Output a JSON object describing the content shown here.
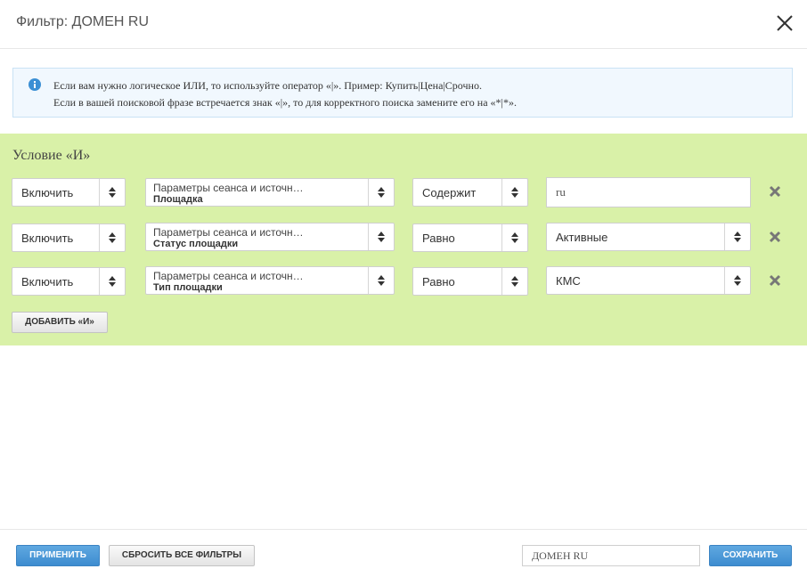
{
  "header": {
    "title": "Фильтр: ДОМЕН RU",
    "close_icon": "close-icon"
  },
  "info": {
    "icon": "info-icon",
    "accent": "#3b8fd4",
    "line1": "Если вам нужно логическое ИЛИ, то используйте оператор «|». Пример: Купить|Цена|Срочно.",
    "line2": "Если в вашей поисковой фразе встречается знак «|», то для корректного поиска замените его на «*|*»."
  },
  "group": {
    "title": "Условие «И»",
    "background": "#d9f1a8",
    "rows": [
      {
        "mode": "Включить",
        "param_line1": "Параметры сеанса и источн…",
        "param_line2": "Площадка",
        "operator": "Содержит",
        "value": "ru"
      },
      {
        "mode": "Включить",
        "param_line1": "Параметры сеанса и источн…",
        "param_line2": "Статус площадки",
        "operator": "Равно",
        "value": "Активные"
      },
      {
        "mode": "Включить",
        "param_line1": "Параметры сеанса и источн…",
        "param_line2": "Тип площадки",
        "operator": "Равно",
        "value": "КМС"
      }
    ],
    "add_button": "ДОБАВИТЬ «И»"
  },
  "footer": {
    "apply_button": "ПРИМЕНИТЬ",
    "reset_button": "СБРОСИТЬ ВСЕ ФИЛЬТРЫ",
    "filter_name": "ДОМЕН RU",
    "save_button": "СОХРАНИТЬ",
    "primary_color": "#4a98d8"
  }
}
